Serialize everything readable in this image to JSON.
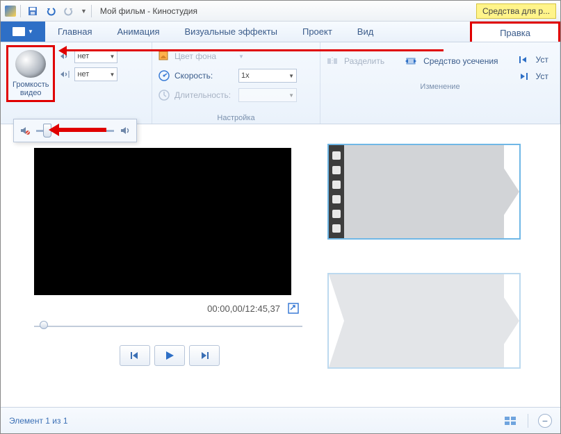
{
  "titlebar": {
    "title": "Мой фильм - Киностудия",
    "context_tab_hint": "Средства для р..."
  },
  "tabs": {
    "main": "Главная",
    "animation": "Анимация",
    "visual_effects": "Визуальные эффекты",
    "project": "Проект",
    "view": "Вид",
    "edit": "Правка"
  },
  "ribbon": {
    "volume_btn": "Громкость\nвидео",
    "fade_value": "нет",
    "bg_color": "Цвет фона",
    "speed_label": "Скорость:",
    "speed_value": "1x",
    "duration_label": "Длительность:",
    "settings_group": "Настройка",
    "split": "Разделить",
    "trim_tool": "Средство усечения",
    "set_start": "Уст",
    "set_end": "Уст",
    "change_group": "Изменение"
  },
  "preview": {
    "current_time": "00:00,00",
    "total_time": "12:45,37"
  },
  "status": {
    "element_text": "Элемент 1 из 1"
  }
}
